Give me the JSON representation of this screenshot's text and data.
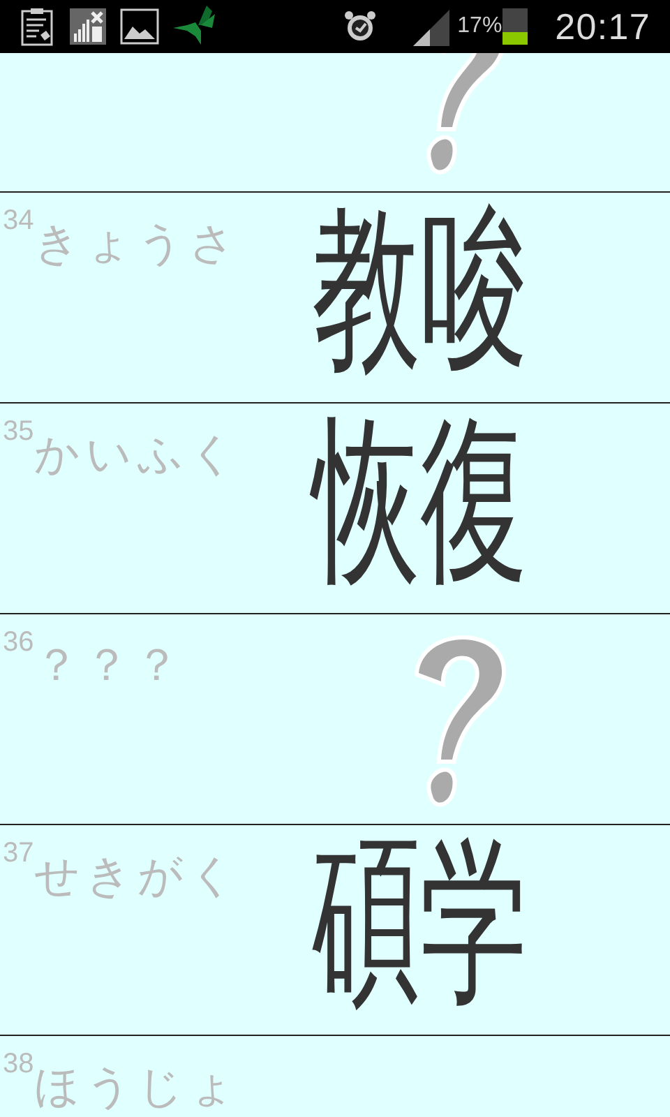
{
  "status_bar": {
    "battery_percent": "17%",
    "time": "20:17",
    "battery": {
      "level": 0.35
    }
  },
  "cards": [
    {
      "kind": "unknown"
    },
    {
      "kind": "known",
      "number": "34",
      "reading": "きょうさ",
      "kanji": "教唆"
    },
    {
      "kind": "known",
      "number": "35",
      "reading": "かいふく",
      "kanji": "恢復"
    },
    {
      "kind": "unknown",
      "number": "36",
      "reading": "？？？"
    },
    {
      "kind": "known",
      "number": "37",
      "reading": "せきがく",
      "kanji": "碩学"
    },
    {
      "kind": "cut",
      "number": "38",
      "reading": "ほうじょ"
    }
  ]
}
